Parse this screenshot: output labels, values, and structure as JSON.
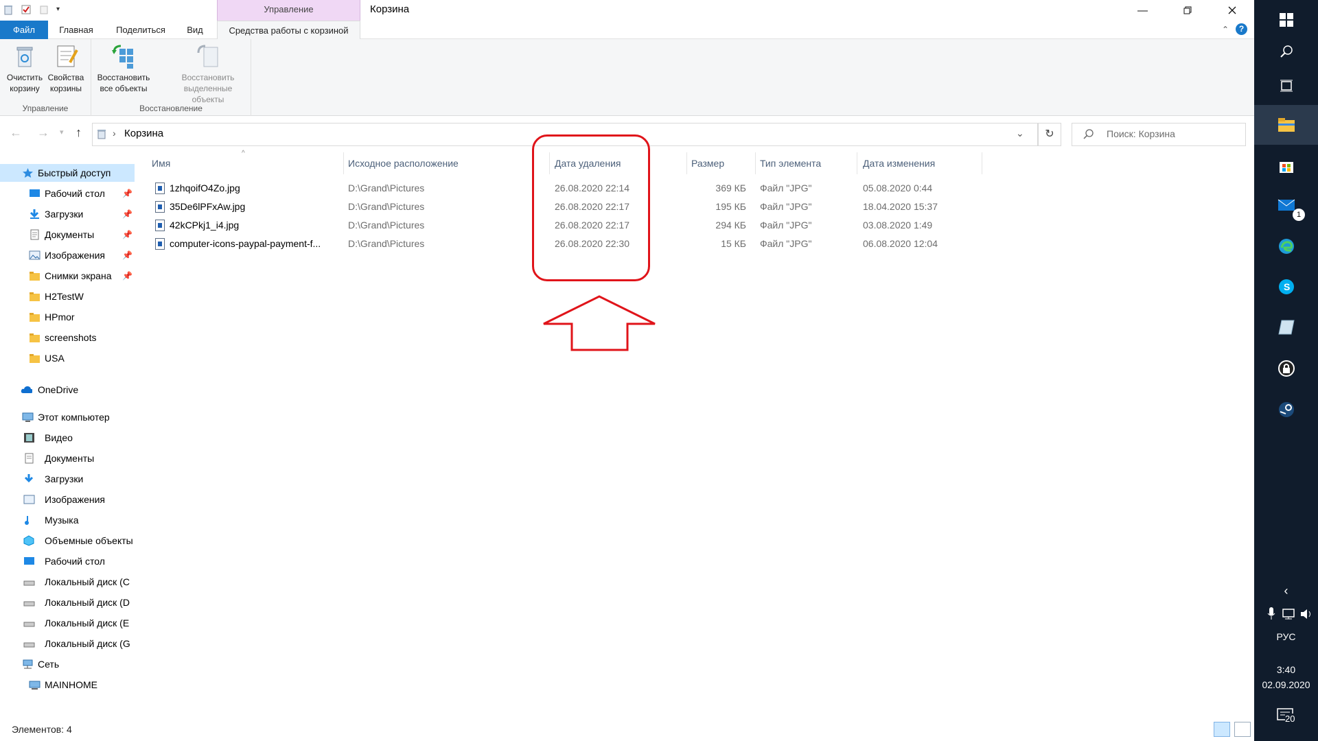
{
  "window": {
    "title": "Корзина",
    "context_tab_header": "Управление"
  },
  "tabs": [
    "Файл",
    "Главная",
    "Поделиться",
    "Вид",
    "Средства работы с корзиной"
  ],
  "ribbon": {
    "empty_bin": [
      "Очистить",
      "корзину"
    ],
    "bin_props": [
      "Свойства",
      "корзины"
    ],
    "group_manage": "Управление",
    "restore_all": [
      "Восстановить",
      "все объекты"
    ],
    "restore_selected": [
      "Восстановить",
      "выделенные объекты"
    ],
    "group_restore": "Восстановление"
  },
  "address": {
    "path": "Корзина",
    "search_placeholder": "Поиск: Корзина"
  },
  "nav": {
    "quick_access": "Быстрый доступ",
    "quick_items": [
      {
        "label": "Рабочий стол",
        "pinned": true
      },
      {
        "label": "Загрузки",
        "pinned": true
      },
      {
        "label": "Документы",
        "pinned": true
      },
      {
        "label": "Изображения",
        "pinned": true
      },
      {
        "label": "Снимки экрана",
        "pinned": true
      },
      {
        "label": "H2TestW",
        "pinned": false
      },
      {
        "label": "HPmor",
        "pinned": false
      },
      {
        "label": "screenshots",
        "pinned": false
      },
      {
        "label": "USA",
        "pinned": false
      }
    ],
    "onedrive": "OneDrive",
    "this_pc": "Этот компьютер",
    "pc_items": [
      "Видео",
      "Документы",
      "Загрузки",
      "Изображения",
      "Музыка",
      "Объемные объекты",
      "Рабочий стол",
      "Локальный диск (C",
      "Локальный диск (D",
      "Локальный диск (E",
      "Локальный диск (G"
    ],
    "network": "Сеть",
    "network_items": [
      "MAINHOME"
    ]
  },
  "columns": [
    "Имя",
    "Исходное расположение",
    "Дата удаления",
    "Размер",
    "Тип элемента",
    "Дата изменения"
  ],
  "files": [
    {
      "name": "1zhqoifO4Zo.jpg",
      "location": "D:\\Grand\\Pictures",
      "deleted": "26.08.2020 22:14",
      "size": "369 КБ",
      "type": "Файл \"JPG\"",
      "modified": "05.08.2020 0:44"
    },
    {
      "name": "35De6lPFxAw.jpg",
      "location": "D:\\Grand\\Pictures",
      "deleted": "26.08.2020 22:17",
      "size": "195 КБ",
      "type": "Файл \"JPG\"",
      "modified": "18.04.2020 15:37"
    },
    {
      "name": "42kCPkj1_i4.jpg",
      "location": "D:\\Grand\\Pictures",
      "deleted": "26.08.2020 22:17",
      "size": "294 КБ",
      "type": "Файл \"JPG\"",
      "modified": "03.08.2020 1:49"
    },
    {
      "name": "computer-icons-paypal-payment-f...",
      "location": "D:\\Grand\\Pictures",
      "deleted": "26.08.2020 22:30",
      "size": "15 КБ",
      "type": "Файл \"JPG\"",
      "modified": "06.08.2020 12:04"
    }
  ],
  "status": {
    "items": "Элементов: 4"
  },
  "taskbar": {
    "mail_badge": "1",
    "lang": "РУС",
    "time": "3:40",
    "date": "02.09.2020",
    "notif_count": "20"
  },
  "colors": {
    "annotation": "#e0141a",
    "file_tab": "#1979ca",
    "context_tab": "#f0d8f5",
    "taskbar": "#101c2c"
  }
}
